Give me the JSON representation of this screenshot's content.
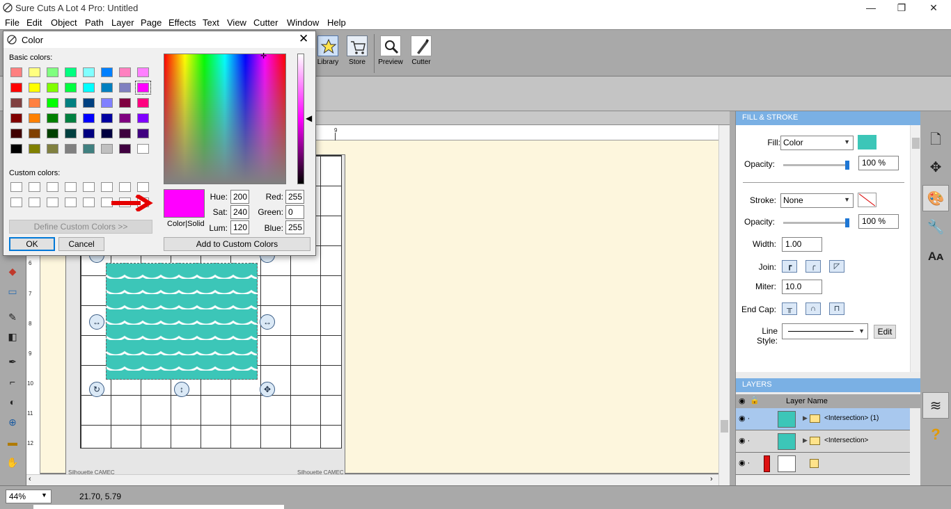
{
  "window": {
    "title": "Sure Cuts A Lot 4 Pro: Untitled",
    "buttons": [
      "—",
      "❐",
      "✕"
    ]
  },
  "menu": [
    "File",
    "Edit",
    "Object",
    "Path",
    "Layer",
    "Page",
    "Effects",
    "Text",
    "View",
    "Cutter",
    "Window",
    "Help"
  ],
  "toolbar": {
    "buttons": [
      {
        "label": "Library",
        "icon": "star-icon"
      },
      {
        "label": "Store",
        "icon": "cart-icon"
      },
      {
        "label": "Preview",
        "icon": "magnifier-icon"
      },
      {
        "label": "Cutter",
        "icon": "pen-cutter-icon"
      }
    ]
  },
  "canvas": {
    "ruler_top_mark": "9",
    "ruler_left_marks": [
      "6",
      "7",
      "8",
      "9",
      "10",
      "11",
      "12"
    ],
    "mat_label_left": "Silhouette CAMEC",
    "mat_label_right": "Silhouette CAMEC",
    "handles": [
      "↔",
      "↔",
      "↕",
      "↻",
      "✥"
    ]
  },
  "status": {
    "zoom": "44%",
    "coords": "21.70, 5.79"
  },
  "color_dialog": {
    "title": "Color",
    "close": "✕",
    "basic_colors_label": "Basic colors:",
    "basic_colors": [
      [
        "#ff8080",
        "#ffff80",
        "#80ff80",
        "#00ff80",
        "#80ffff",
        "#0080ff",
        "#ff80c0",
        "#ff80ff"
      ],
      [
        "#ff0000",
        "#ffff00",
        "#80ff00",
        "#00ff40",
        "#00ffff",
        "#0080c0",
        "#8080c0",
        "#ff00ff"
      ],
      [
        "#804040",
        "#ff8040",
        "#00ff00",
        "#008080",
        "#004080",
        "#8080ff",
        "#800040",
        "#ff0080"
      ],
      [
        "#800000",
        "#ff8000",
        "#008000",
        "#008040",
        "#0000ff",
        "#0000a0",
        "#800080",
        "#8000ff"
      ],
      [
        "#400000",
        "#804000",
        "#004000",
        "#004040",
        "#000080",
        "#000040",
        "#400040",
        "#400080"
      ],
      [
        "#000000",
        "#808000",
        "#808040",
        "#808080",
        "#408080",
        "#c0c0c0",
        "#400040",
        "#ffffff"
      ]
    ],
    "selected_color": "#ff00ff",
    "custom_colors_label": "Custom colors:",
    "define_custom": "Define Custom Colors >>",
    "ok": "OK",
    "cancel": "Cancel",
    "color_solid_label": "Color|Solid",
    "hue_label": "Hue:",
    "hue": "200",
    "sat_label": "Sat:",
    "sat": "240",
    "lum_label": "Lum:",
    "lum": "120",
    "red_label": "Red:",
    "red": "255",
    "green_label": "Green:",
    "green": "0",
    "blue_label": "Blue:",
    "blue": "255",
    "add_custom": "Add to Custom Colors"
  },
  "fill_stroke": {
    "header": "FILL & STROKE",
    "fill_label": "Fill:",
    "fill_value": "Color",
    "fill_color": "#3cc6b8",
    "opacity_label": "Opacity:",
    "fill_opacity": "100 %",
    "fill_opacity_value": 1.0,
    "stroke_label": "Stroke:",
    "stroke_value": "None",
    "stroke_opacity_label": "Opacity:",
    "stroke_opacity": "100 %",
    "stroke_opacity_value": 1.0,
    "width_label": "Width:",
    "width_value": "1.00",
    "join_label": "Join:",
    "miter_label": "Miter:",
    "miter_value": "10.0",
    "endcap_label": "End Cap:",
    "linestyle_label": "Line Style:",
    "edit_button": "Edit"
  },
  "layers": {
    "header": "LAYERS",
    "column": "Layer Name",
    "rows": [
      {
        "name": "<Intersection> (1)",
        "selected": true
      },
      {
        "name": "<Intersection>",
        "selected": false
      },
      {
        "name": "",
        "selected": false
      }
    ]
  },
  "side_icons": [
    "page-icon",
    "move-icon",
    "palette-icon",
    "wrench-icon",
    "text-icon",
    "layers-icon",
    "help-icon"
  ],
  "accent": "#7ab0e4"
}
